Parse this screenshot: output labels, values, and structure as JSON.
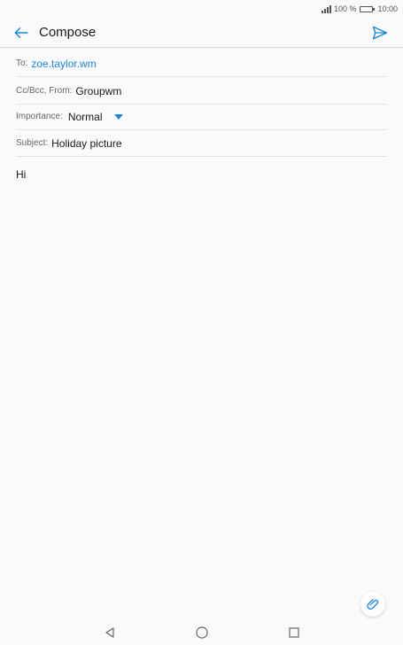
{
  "status_bar": {
    "battery_percent": "100 %",
    "time": "10:00",
    "icons": [
      "signal-icon",
      "battery-icon"
    ]
  },
  "app_bar": {
    "title": "Compose",
    "back_icon": "back-arrow-icon",
    "send_icon": "send-icon"
  },
  "fields": {
    "to": {
      "label": "To:",
      "value": "zoe.taylor.wm"
    },
    "cc_bcc_from": {
      "label": "Cc/Bcc, From:",
      "value": "Groupwm"
    },
    "importance": {
      "label": "Importance:",
      "value": "Normal"
    },
    "subject": {
      "label": "Subject:",
      "value": "Holiday picture"
    }
  },
  "body": {
    "text": "Hi"
  },
  "attach": {
    "icon": "paperclip-icon"
  },
  "nav": {
    "icons": [
      "nav-back-icon",
      "nav-home-icon",
      "nav-recents-icon"
    ]
  },
  "colors": {
    "accent": "#1a88d7",
    "background": "#fafafc"
  }
}
